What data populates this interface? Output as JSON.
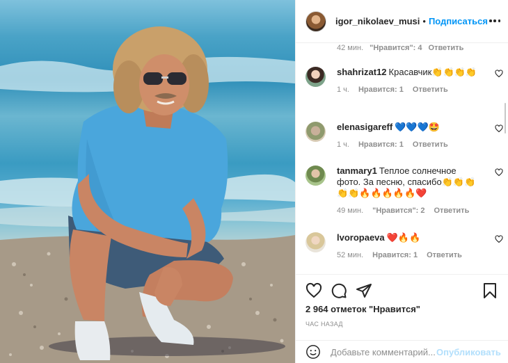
{
  "header": {
    "username": "igor_nikolaev_musi",
    "dot": "•",
    "follow_label": "Подписаться"
  },
  "top_meta": {
    "time": "42 мин.",
    "likes": "\"Нравится\": 4",
    "reply": "Ответить"
  },
  "comments": [
    {
      "user": "shahrizat12",
      "text": "Красавчик👏👏👏👏",
      "time": "1 ч.",
      "likes": "Нравится: 1",
      "reply": "Ответить"
    },
    {
      "user": "elenasigareff",
      "text": "💙💙💙🤩",
      "time": "1 ч.",
      "likes": "Нравится: 1",
      "reply": "Ответить"
    },
    {
      "user": "tanmary1",
      "text": "Теплое солнечное фото. За песню, спасибо👏👏👏👏👏🔥🔥🔥🔥🔥❤️",
      "time": "49 мин.",
      "likes": "\"Нравится\": 2",
      "reply": "Ответить"
    },
    {
      "user": "lvoropaeva",
      "text": "❤️🔥🔥",
      "time": "52 мин.",
      "likes": "Нравится: 1",
      "reply": "Ответить"
    }
  ],
  "likes_count": "2 964 отметок \"Нравится\"",
  "post_time": "ЧАС НАЗАД",
  "composer": {
    "placeholder": "Добавьте комментарий...",
    "post_label": "Опубликовать"
  },
  "colors": {
    "accent": "#0095f6",
    "post_disabled": "#b2dffc",
    "muted": "#8e8e8e"
  },
  "icons": [
    "more-icon",
    "heart-icon",
    "comment-icon",
    "share-icon",
    "bookmark-icon",
    "smile-icon"
  ]
}
